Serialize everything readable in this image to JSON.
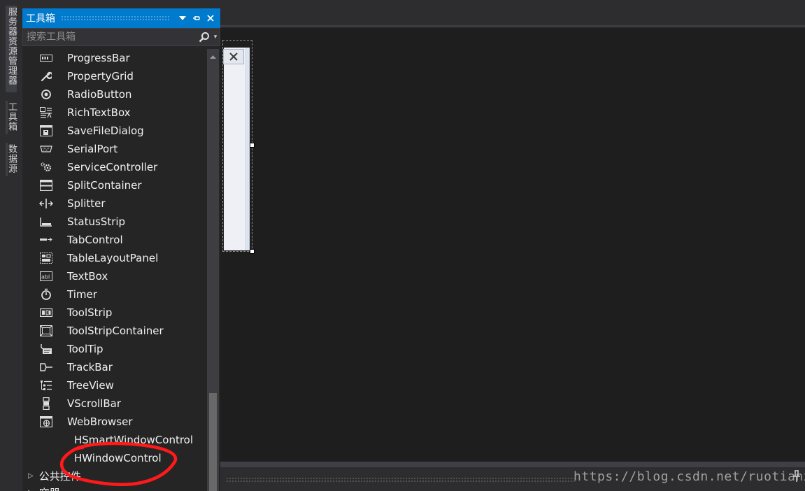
{
  "side_tabs": [
    {
      "label": "服务器资源管理器"
    },
    {
      "label": "工具箱"
    },
    {
      "label": "数据源"
    }
  ],
  "toolbox": {
    "title": "工具箱",
    "search_placeholder": "搜索工具箱",
    "items": [
      {
        "label": "ProgressBar",
        "icon": "progressbar-icon"
      },
      {
        "label": "PropertyGrid",
        "icon": "wrench-icon"
      },
      {
        "label": "RadioButton",
        "icon": "radio-icon"
      },
      {
        "label": "RichTextBox",
        "icon": "richtextbox-icon"
      },
      {
        "label": "SaveFileDialog",
        "icon": "save-dialog-icon"
      },
      {
        "label": "SerialPort",
        "icon": "serial-port-icon"
      },
      {
        "label": "ServiceController",
        "icon": "gear-icon"
      },
      {
        "label": "SplitContainer",
        "icon": "split-container-icon"
      },
      {
        "label": "Splitter",
        "icon": "splitter-icon"
      },
      {
        "label": "StatusStrip",
        "icon": "status-strip-icon"
      },
      {
        "label": "TabControl",
        "icon": "tab-control-icon"
      },
      {
        "label": "TableLayoutPanel",
        "icon": "table-layout-icon"
      },
      {
        "label": "TextBox",
        "icon": "textbox-icon"
      },
      {
        "label": "Timer",
        "icon": "timer-icon"
      },
      {
        "label": "ToolStrip",
        "icon": "toolstrip-icon"
      },
      {
        "label": "ToolStripContainer",
        "icon": "toolstrip-container-icon"
      },
      {
        "label": "ToolTip",
        "icon": "tooltip-icon"
      },
      {
        "label": "TrackBar",
        "icon": "trackbar-icon"
      },
      {
        "label": "TreeView",
        "icon": "treeview-icon"
      },
      {
        "label": "VScrollBar",
        "icon": "vscrollbar-icon"
      },
      {
        "label": "WebBrowser",
        "icon": "webbrowser-icon"
      },
      {
        "label": "HSmartWindowControl",
        "icon": ""
      },
      {
        "label": "HWindowControl",
        "icon": ""
      }
    ],
    "groups": [
      {
        "label": "公共控件"
      },
      {
        "label": "容器"
      }
    ]
  },
  "watermark": "https://blog.csdn.net/ruotianxia",
  "colors": {
    "accent": "#007acc",
    "panel_bg": "#252526",
    "editor_bg": "#1e1e1e",
    "annotation": "#ff1a1a"
  }
}
